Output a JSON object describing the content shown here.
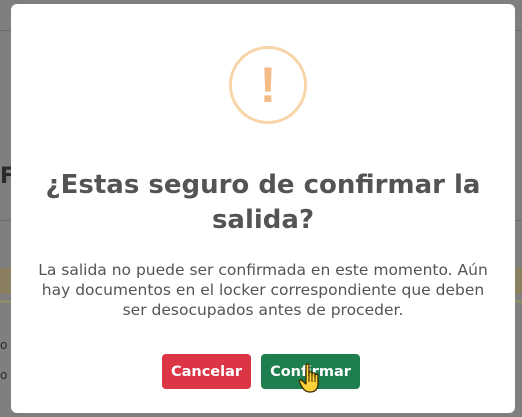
{
  "background": {
    "fragment_letter": "F",
    "fragment_lines": [
      "o",
      "o"
    ]
  },
  "dialog": {
    "icon": "exclamation-icon",
    "icon_glyph": "!",
    "title": "¿Estas seguro de confirmar la salida?",
    "message": "La salida no puede ser confirmada en este momento. Aún hay documentos en el locker correspondiente que deben ser desocupados antes de proceder.",
    "cancel_label": "Cancelar",
    "confirm_label": "Confirmar"
  },
  "colors": {
    "cancel": "#dc3545",
    "confirm": "#1e7e4e",
    "warning_ring": "#f8d4a8",
    "warning_glyph": "#f5bb86",
    "text": "#545454"
  },
  "cursor": "hand-pointer-icon"
}
